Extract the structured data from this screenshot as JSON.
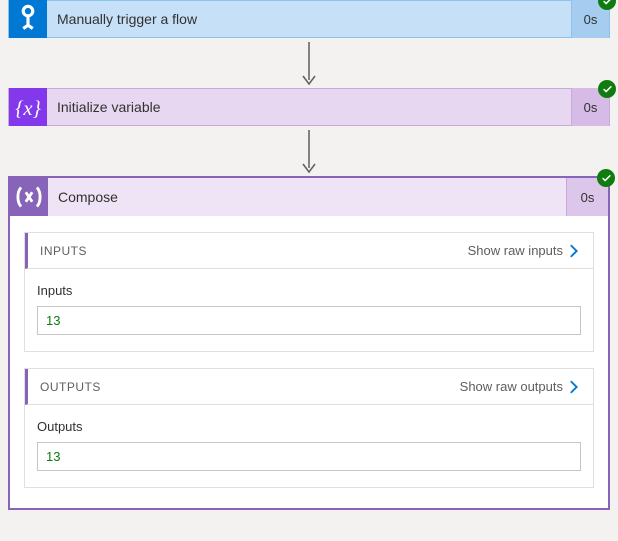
{
  "steps": {
    "trigger": {
      "title": "Manually trigger a flow",
      "duration": "0s"
    },
    "init": {
      "title": "Initialize variable",
      "duration": "0s"
    },
    "compose": {
      "title": "Compose",
      "duration": "0s"
    }
  },
  "compose_detail": {
    "inputs_section": {
      "heading": "INPUTS",
      "raw_link": "Show raw inputs",
      "field_label": "Inputs",
      "field_value": "13"
    },
    "outputs_section": {
      "heading": "OUTPUTS",
      "raw_link": "Show raw outputs",
      "field_label": "Outputs",
      "field_value": "13"
    }
  }
}
